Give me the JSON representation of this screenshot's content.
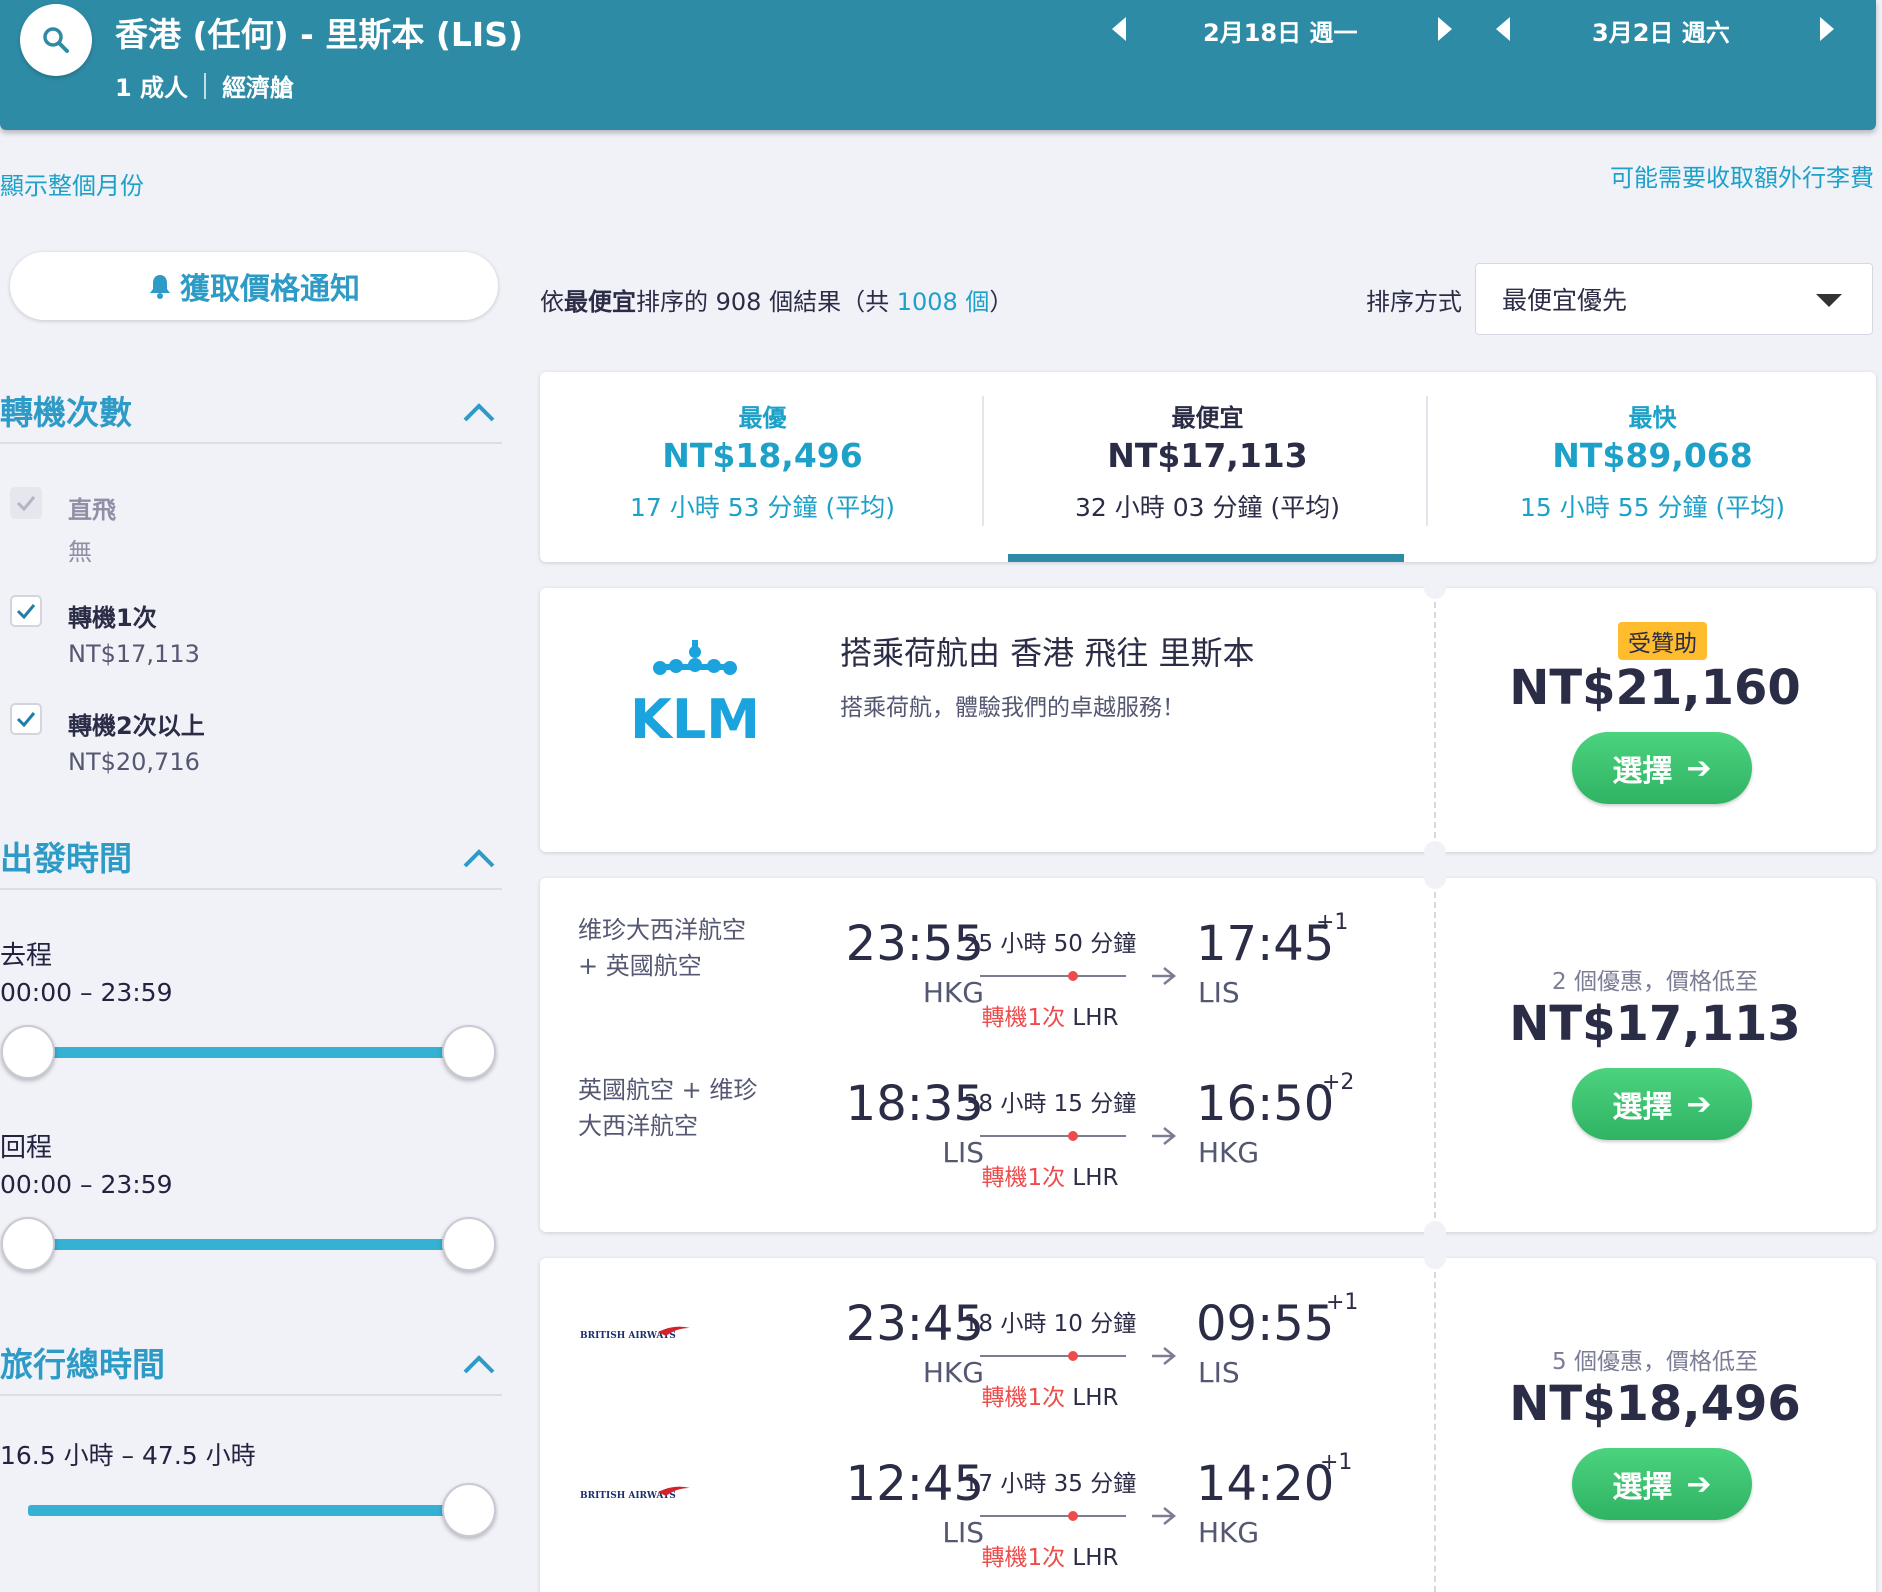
{
  "header": {
    "route": "香港 (任何) - 里斯本 (LIS)",
    "passengers": "1 成人",
    "cabin": "經濟艙",
    "depart_date": "2月18日 週一",
    "return_date": "3月2日 週六"
  },
  "links": {
    "show_month": "顯示整個月份",
    "baggage_fee": "可能需要收取額外行李費"
  },
  "sidebar": {
    "price_alert": "獲取價格通知",
    "stops": {
      "title": "轉機次數",
      "options": [
        {
          "label": "直飛",
          "price": "無",
          "checked": true,
          "disabled": true
        },
        {
          "label": "轉機1次",
          "price": "NT$17,113",
          "checked": true,
          "disabled": false
        },
        {
          "label": "轉機2次以上",
          "price": "NT$20,716",
          "checked": true,
          "disabled": false
        }
      ]
    },
    "departure_times": {
      "title": "出發時間",
      "outbound_label": "去程",
      "outbound_range": "00:00 – 23:59",
      "return_label": "回程",
      "return_range": "00:00 – 23:59"
    },
    "duration": {
      "title": "旅行總時間",
      "range": "16.5 小時 – 47.5 小時"
    }
  },
  "results": {
    "prefix": "依",
    "sort_bold": "最便宜",
    "middle": "排序的 908 個結果（共 ",
    "total": "1008 個",
    "suffix": "）",
    "sort_label": "排序方式",
    "sort_value": "最便宜優先"
  },
  "tabs": [
    {
      "label": "最優",
      "price": "NT$18,496",
      "duration": "17 小時 53 分鐘 (平均)"
    },
    {
      "label": "最便宜",
      "price": "NT$17,113",
      "duration": "32 小時 03 分鐘 (平均)"
    },
    {
      "label": "最快",
      "price": "NT$89,068",
      "duration": "15 小時 55 分鐘 (平均)"
    }
  ],
  "ad": {
    "logo_text": "KLM",
    "title": "搭乘荷航由 香港 飛往 里斯本",
    "description": "搭乘荷航，體驗我們的卓越服務！",
    "sponsored": "受贊助",
    "price": "NT$21,160",
    "select": "選擇"
  },
  "flights": [
    {
      "deals": "2 個優惠，價格低至",
      "price": "NT$17,113",
      "select": "選擇",
      "legs": [
        {
          "airline": "维珍大西洋航空 + 英國航空",
          "dep_time": "23:55",
          "dep_code": "HKG",
          "duration": "25 小時 50 分鐘",
          "stops": "轉機1次",
          "via": "LHR",
          "arr_time": "17:45",
          "arr_plus": "+1",
          "arr_code": "LIS"
        },
        {
          "airline": "英國航空 + 维珍大西洋航空",
          "dep_time": "18:35",
          "dep_code": "LIS",
          "duration": "38 小時 15 分鐘",
          "stops": "轉機1次",
          "via": "LHR",
          "arr_time": "16:50",
          "arr_plus": "+2",
          "arr_code": "HKG"
        }
      ]
    },
    {
      "deals": "5 個優惠，價格低至",
      "price": "NT$18,496",
      "select": "選擇",
      "legs": [
        {
          "airline_logo": "BRITISH AIRWAYS",
          "dep_time": "23:45",
          "dep_code": "HKG",
          "duration": "18 小時 10 分鐘",
          "stops": "轉機1次",
          "via": "LHR",
          "arr_time": "09:55",
          "arr_plus": "+1",
          "arr_code": "LIS"
        },
        {
          "airline_logo": "BRITISH AIRWAYS",
          "dep_time": "12:45",
          "dep_code": "LIS",
          "duration": "17 小時 35 分鐘",
          "stops": "轉機1次",
          "via": "LHR",
          "arr_time": "14:20",
          "arr_plus": "+1",
          "arr_code": "HKG"
        }
      ]
    }
  ],
  "colors": {
    "header_bg": "#2e8ba6",
    "accent": "#1ea1c9",
    "select_green": "#3cc472",
    "stop_red": "#ee4b4b",
    "sponsor_yellow": "#ffbc2c"
  }
}
